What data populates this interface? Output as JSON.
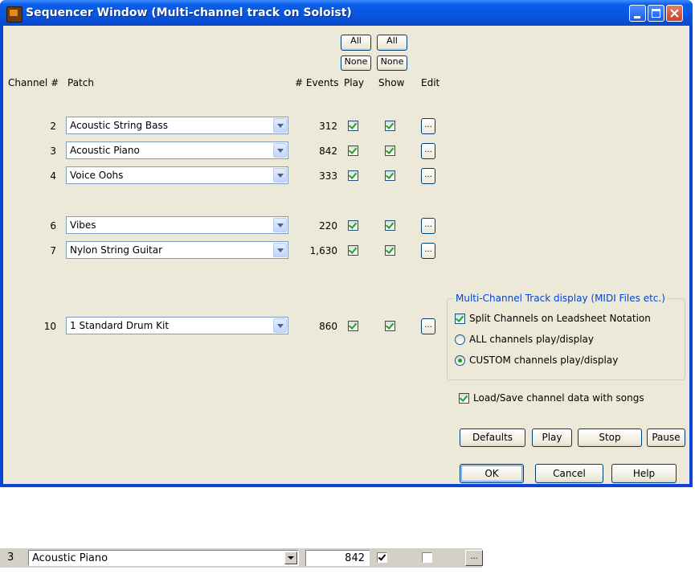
{
  "window": {
    "title": "Sequencer Window  (Multi-channel track on Soloist)",
    "controls": [
      "minimize-icon",
      "maximize-icon",
      "close-icon"
    ]
  },
  "headers": {
    "channel": "Channel #",
    "patch": "Patch",
    "events": "# Events",
    "play": "Play",
    "show": "Show",
    "edit": "Edit",
    "all_label": "All",
    "none_label": "None"
  },
  "rows": [
    {
      "channel": "2",
      "patch": "Acoustic String Bass",
      "events": "312",
      "play": true,
      "show": true,
      "edit": "..."
    },
    {
      "channel": "3",
      "patch": "Acoustic Piano",
      "events": "842",
      "play": true,
      "show": true,
      "edit": "..."
    },
    {
      "channel": "4",
      "patch": "Voice Oohs",
      "events": "333",
      "play": true,
      "show": true,
      "edit": "..."
    },
    {
      "channel": "6",
      "patch": "Vibes",
      "events": "220",
      "play": true,
      "show": true,
      "edit": "..."
    },
    {
      "channel": "7",
      "patch": "Nylon String Guitar",
      "events": "1,630",
      "play": true,
      "show": true,
      "edit": "..."
    },
    {
      "channel": "10",
      "patch": "1 Standard Drum Kit",
      "events": "860",
      "play": true,
      "show": true,
      "edit": "..."
    }
  ],
  "display_group": {
    "title": "Multi-Channel Track display (MIDI Files etc.)",
    "split_channels": {
      "label": "Split Channels on Leadsheet Notation",
      "checked": true
    },
    "radio_all": {
      "label": "ALL channels play/display",
      "selected": false
    },
    "radio_custom": {
      "label": "CUSTOM channels play/display",
      "selected": true
    }
  },
  "load_save": {
    "label": "Load/Save channel data with songs",
    "checked": true
  },
  "buttons": {
    "defaults": "Defaults",
    "play": "Play",
    "stop": "Stop",
    "pause": "Pause",
    "ok": "OK",
    "cancel": "Cancel",
    "help": "Help"
  },
  "strip": {
    "channel": "3",
    "patch": "Acoustic Piano",
    "events": "842",
    "play": true,
    "show": false,
    "edit": "..."
  },
  "colors": {
    "titlebar": "#0a5ee8",
    "dialog_bg": "#ece9d8",
    "group_title": "#0046d5",
    "check_green": "#21a121"
  }
}
